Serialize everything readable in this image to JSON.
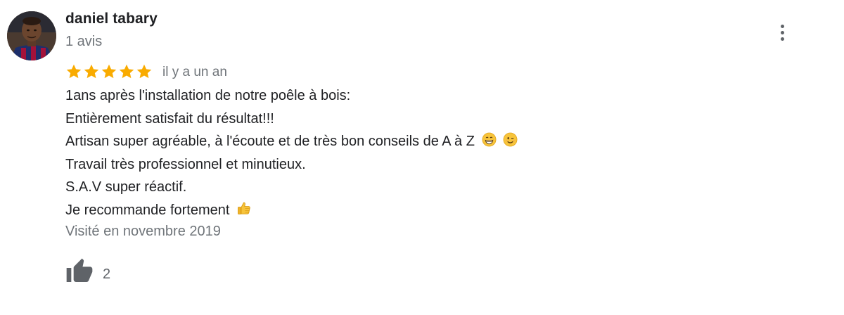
{
  "reviewer": {
    "name": "daniel tabary",
    "review_count": "1 avis"
  },
  "rating": {
    "stars": 5,
    "max_stars": 5,
    "star_color": "#f9ab00",
    "time_ago": "il y a un an"
  },
  "review": {
    "lines": [
      "1ans après l'installation de notre poêle à bois:",
      "Entièrement satisfait du résultat!!!",
      "Artisan super agréable, à l'écoute et de très bon conseils de A à Z",
      "Travail très professionnel et minutieux.",
      "S.A.V super réactif.",
      "Je recommande fortement"
    ],
    "emojis": {
      "line_3": [
        "grinning-face-icon",
        "winking-face-icon"
      ],
      "line_6": [
        "thumbs-up-icon"
      ]
    }
  },
  "visit": {
    "date_text": "Visité en novembre 2019"
  },
  "actions": {
    "like_count": "2",
    "more_options_icon": "more-vertical-icon"
  },
  "colors": {
    "text_primary": "#202124",
    "text_secondary": "#70757a",
    "icon_gray": "#5f6368"
  }
}
